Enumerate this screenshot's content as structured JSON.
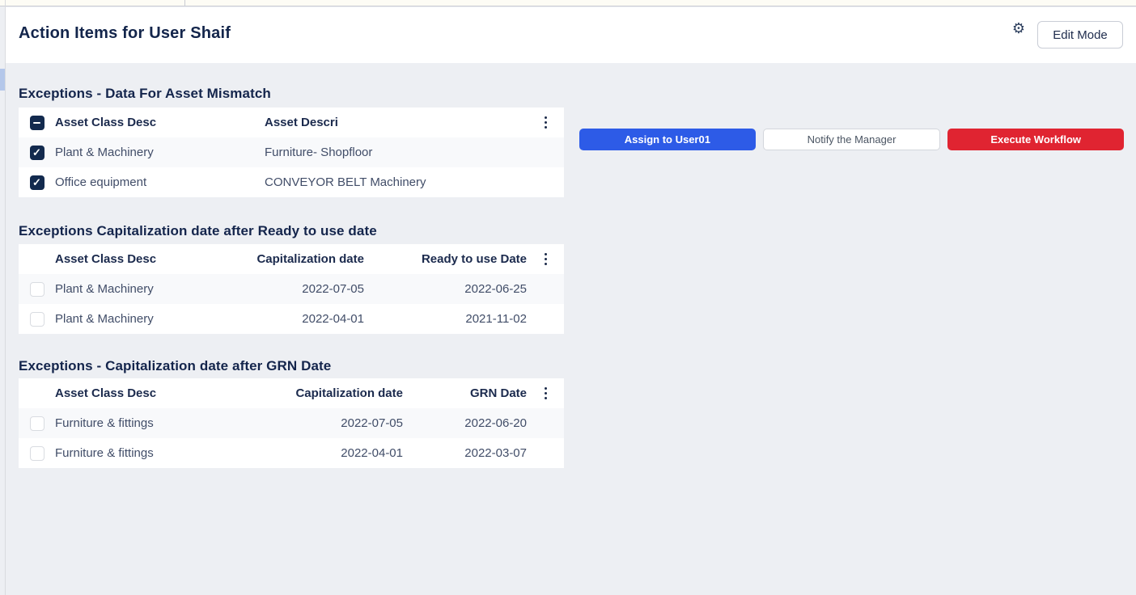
{
  "header": {
    "title": "Action Items for User Shaif",
    "edit_button_label": "Edit Mode"
  },
  "icons": {
    "gear_glyph": "⚙",
    "check_glyph": "✓"
  },
  "action_buttons": [
    {
      "label": "Assign to User01",
      "variant": "primary",
      "color": "#2d5be7"
    },
    {
      "label": "Notify the Manager",
      "variant": "secondary",
      "color": "#ffffff"
    },
    {
      "label": "Execute Workflow",
      "variant": "danger",
      "color": "#e02431"
    }
  ],
  "sections": [
    {
      "title": "Exceptions - Data For Asset Mismatch",
      "header_checkbox_state": "indeterminate",
      "columns": {
        "c1": "Asset Class Desc",
        "c2": "Asset Descri"
      },
      "rows": [
        {
          "checked": true,
          "c1": "Plant & Machinery",
          "c2": "Furniture- Shopfloor"
        },
        {
          "checked": true,
          "c1": "Office equipment",
          "c2": "CONVEYOR BELT Machinery"
        }
      ]
    },
    {
      "title": "Exceptions Capitalization date after Ready to use date",
      "header_checkbox_state": "none",
      "columns": {
        "c1": "Asset Class Desc",
        "c2": "Capitalization date",
        "c3": "Ready to use Date"
      },
      "rows": [
        {
          "checked": false,
          "c1": "Plant & Machinery",
          "c2": "2022-07-05",
          "c3": "2022-06-25"
        },
        {
          "checked": false,
          "c1": "Plant & Machinery",
          "c2": "2022-04-01",
          "c3": "2021-11-02"
        }
      ]
    },
    {
      "title": "Exceptions - Capitalization date after GRN Date",
      "header_checkbox_state": "none",
      "columns": {
        "c1": "Asset Class Desc",
        "c2": "Capitalization date",
        "c3": "GRN Date"
      },
      "rows": [
        {
          "checked": false,
          "c1": "Furniture & fittings",
          "c2": "2022-07-05",
          "c3": "2022-06-20"
        },
        {
          "checked": false,
          "c1": "Furniture & fittings",
          "c2": "2022-04-01",
          "c3": "2022-03-07"
        }
      ]
    }
  ],
  "colors": {
    "page_background": "#edeff3",
    "card_background": "#ffffff",
    "row_stripe": "#f8f9fb",
    "title_text": "#13254b",
    "cell_text": "#414d68",
    "checkbox_fill": "#132a4e",
    "primary_button": "#2d5be7",
    "danger_button": "#e02431",
    "scrollbar_thumb": "#b4c7ea"
  }
}
